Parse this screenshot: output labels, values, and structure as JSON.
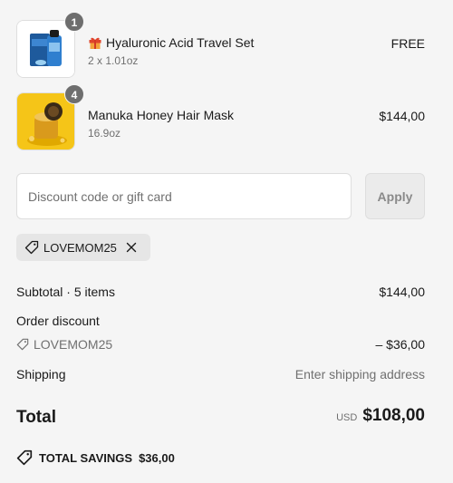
{
  "line_items": [
    {
      "quantity": "1",
      "gift": true,
      "title": "Hyaluronic Acid Travel Set",
      "subtitle": "2 x 1.01oz",
      "price": "FREE",
      "image_icon": "skincare-travel-set-icon"
    },
    {
      "quantity": "4",
      "gift": false,
      "title": "Manuka Honey Hair Mask",
      "subtitle": "16.9oz",
      "price": "$144,00",
      "image_icon": "honey-hair-mask-jar-icon"
    }
  ],
  "discount": {
    "placeholder": "Discount code or gift card",
    "apply_label": "Apply",
    "applied_code": "LOVEMOM25"
  },
  "summary": {
    "subtotal_label": "Subtotal · 5 items",
    "subtotal_value": "$144,00",
    "order_discount_label": "Order discount",
    "discount_code": "LOVEMOM25",
    "discount_value": "– $36,00",
    "shipping_label": "Shipping",
    "shipping_value": "Enter shipping address",
    "total_label": "Total",
    "currency": "USD",
    "total_value": "$108,00",
    "savings_label": "TOTAL SAVINGS",
    "savings_value": "$36,00"
  },
  "colors": {
    "background": "#f5f5f5",
    "badge": "#6e6e6e",
    "muted_text": "#707070",
    "gift_red": "#e0442c",
    "honey_yellow": "#f5c518"
  }
}
